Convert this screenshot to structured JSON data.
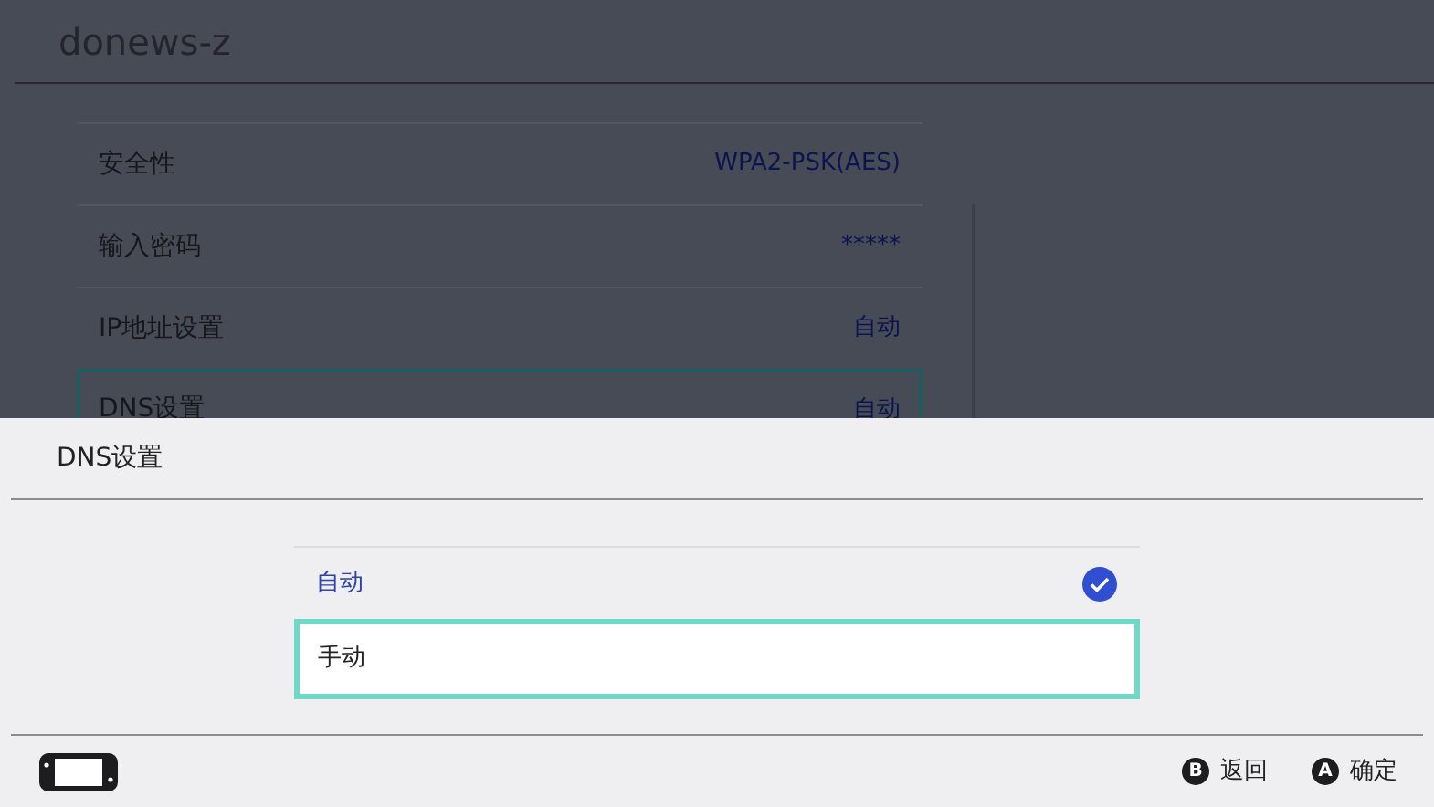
{
  "header": {
    "title": "donews-z"
  },
  "settings": [
    {
      "label": "安全性",
      "value": "WPA2-PSK(AES)",
      "selected": false
    },
    {
      "label": "输入密码",
      "value": "*****",
      "selected": false
    },
    {
      "label": "IP地址设置",
      "value": "自动",
      "selected": false
    },
    {
      "label": "DNS设置",
      "value": "自动",
      "selected": true
    }
  ],
  "dialog": {
    "title": "DNS设置",
    "options": [
      {
        "label": "自动",
        "checked": true,
        "selected": false
      },
      {
        "label": "手动",
        "checked": false,
        "selected": true
      }
    ]
  },
  "footer": {
    "buttons": [
      {
        "key": "B",
        "label": "返回"
      },
      {
        "key": "A",
        "label": "确定"
      }
    ]
  }
}
